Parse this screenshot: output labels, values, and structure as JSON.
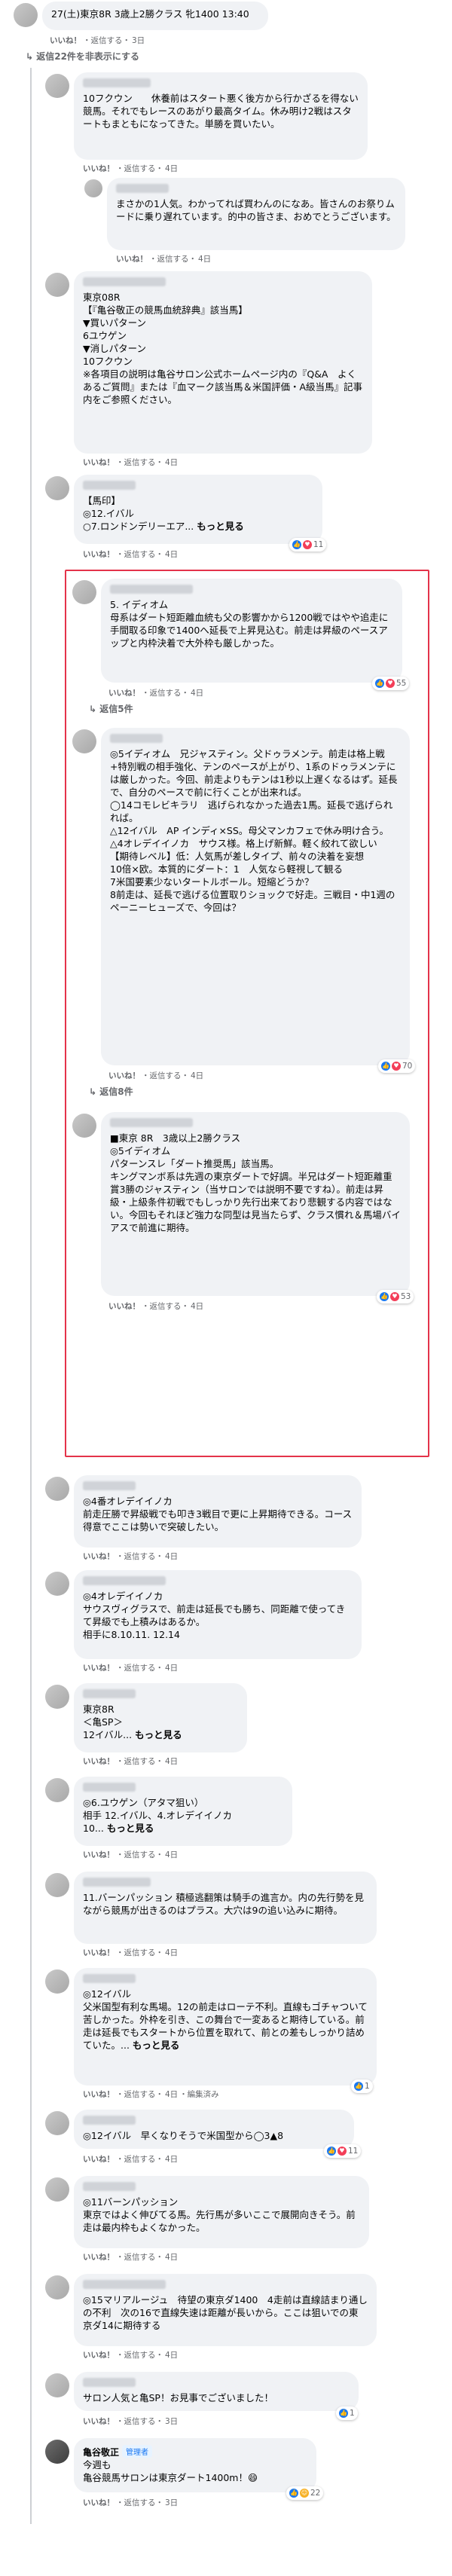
{
  "c0": {
    "text": "27(土)東京8R 3歳上2勝クラス 牝1400 13:40",
    "meta": [
      "いいね！",
      "・返信する・",
      "3日"
    ]
  },
  "hide_replies": "返信22件を非表示にする",
  "c1": {
    "text": "10フクウン　　休養前はスタート悪く後方から行かざるを得ない競馬。それでもレースのあがり最高タイム。休み明け2戦はスタートもまともになってきた。単勝を買いたい。",
    "meta": [
      "いいね！",
      "・返信する・",
      "4日"
    ]
  },
  "c1r": {
    "text": "まさかの1人気。わかってれば買わんのになあ。皆さんのお祭りムードに乗り遅れています。的中の皆さま、おめでとうございます。",
    "meta": [
      "いいね！",
      "・返信する・",
      "4日"
    ]
  },
  "c2": {
    "text": "東京08R\n【『亀谷敬正の競馬血統辞典』該当馬】\n▼買いパターン\n6ユウゲン\n▼消しパターン\n10フクウン\n※各項目の説明は亀谷サロン公式ホームページ内の『Q&A　よくあるご質問』または『血マーク該当馬＆米国評価・A級当馬』記事内をご参照ください。",
    "meta": [
      "いいね！",
      "・返信する・",
      "4日"
    ]
  },
  "c3": {
    "text": "【馬印】\n◎12.イバル\n○7.ロンドンデリーエア...",
    "more": "もっと見る",
    "meta": [
      "いいね！",
      "・返信する・",
      "4日"
    ],
    "reactions": "11"
  },
  "c4": {
    "text": "5. イディオム\n母系はダート短距離血統も父の影響かから1200戦ではやや追走に手間取る印象で1400へ延長で上昇見込む。前走は昇級のペースアップと内枠決着で大外枠も厳しかった。",
    "meta": [
      "いいね！",
      "・返信する・",
      "4日"
    ],
    "reactions": "55",
    "replies": "返信5件"
  },
  "c5": {
    "text": "◎5イディオム　兄ジャスティン。父ドゥラメンテ。前走は格上戦+特別戦の相手強化、テンのペースが上がり、1系のドゥラメンテには厳しかった。今回、前走よりもテンは1秒以上遅くなるはず。延長で、自分のペースで前に行くことが出来れば。\n◯14コモレビキラリ　逃げられなかった過去1馬。延長で逃げられれば。\n△12イバル　AP インディ×SS。母父マンカフェで休み明け合う。\n△4オレデイイノカ　サウス様。格上げ新鮮。軽く絞れて欲しい\n【期待レベル】低：人気馬が差しタイプ、前々の決着を妄想\n10倍×欧。本質的にダート：1　人気なら軽視して観る\n7米国要素少ないタートルボール。短縮どうか？\n8前走は、延長で逃げる位置取りショックで好走。三戦目・中1週のペーニーヒューズで、今回は？",
    "meta": [
      "いいね！",
      "・返信する・",
      "4日"
    ],
    "reactions": "70",
    "replies": "返信8件"
  },
  "c6": {
    "text": "■東京 8R　3歳以上2勝クラス\n◎5イディオム\nパターンスレ「ダート推奨馬」該当馬。\nキングマンボ系は先週の東京ダートで好調。半兄はダート短距離重賞3勝のジャスティン（当サロンでは説明不要ですね）。前走は昇級・上級条件初戦でもしっかり先行出来ており悲観する内容ではない。今回もそれほど強力な同型は見当たらず、クラス慣れ＆馬場バイアスで前進に期待。",
    "meta": [
      "いいね！",
      "・返信する・",
      "4日"
    ],
    "reactions": "53"
  },
  "c7": {
    "text": "◎4番オレデイイノカ\n前走圧勝で昇級戦でも叩き3戦目で更に上昇期待できる。コース得意でここは勢いで突破したい。",
    "meta": [
      "いいね！",
      "・返信する・",
      "4日"
    ]
  },
  "c8": {
    "text": "◎4オレデイイノカ\nサウスヴィグラスで、前走は延長でも勝ち、同距離で使ってきて昇級でも上積みはあるか。\n相手に8.10.11. 12.14",
    "meta": [
      "いいね！",
      "・返信する・",
      "4日"
    ]
  },
  "c9": {
    "text": "東京8R\n＜亀SP＞\n12イバル...",
    "more": "もっと見る",
    "meta": [
      "いいね！",
      "・返信する・",
      "4日"
    ]
  },
  "c10": {
    "text": "◎6.ユウゲン（アタマ狙い）\n相手 12.イバル、4.オレデイイノカ\n10...",
    "more": "もっと見る",
    "meta": [
      "いいね！",
      "・返信する・",
      "4日"
    ]
  },
  "c11": {
    "text": "11.バーンパッション 積極逃翻策は騎手の進言か。内の先行勢を見ながら競馬が出きるのはプラス。大穴は9の追い込みに期待。",
    "meta": [
      "いいね！",
      "・返信する・",
      "4日"
    ]
  },
  "c12": {
    "text": "◎12イバル\n父米国型有利な馬場。12の前走はローテ不利。直線もゴチャついて苦しかった。外枠を引き、この舞台で一変あると期待している。前走は延長でもスタートから位置を取れて、前との差もしっかり詰めていた。...",
    "more": "もっと見る",
    "meta": [
      "いいね！",
      "・返信する・",
      "4日",
      "・編集済み"
    ],
    "reactions": "1"
  },
  "c13": {
    "text": "◎12イバル　早くなりそうで米国型から◯3▲8",
    "meta": [
      "いいね！",
      "・返信する・",
      "4日"
    ],
    "reactions": "11"
  },
  "c14": {
    "text": "◎11バーンパッション\n東京ではよく伸びてる馬。先行馬が多いここで展開向きそう。前走は最内枠もよくなかった。",
    "meta": [
      "いいね！",
      "・返信する・",
      "4日"
    ]
  },
  "c15": {
    "text": "◎15マリアルージュ　待望の東京ダ1400　4走前は直線詰まり通しの不利　次の16で直線失速は距離が長いから。ここは狙いでの東京ダ14に期待する",
    "meta": [
      "いいね！",
      "・返信する・",
      "4日"
    ]
  },
  "c16": {
    "text": "サロン人気と亀SP！お見事でございました！",
    "meta": [
      "いいね！",
      "・返信する・",
      "3日"
    ],
    "reactions": "1"
  },
  "c17": {
    "name": "亀谷敬正",
    "role": "管理者",
    "text": "今週も\n亀谷競馬サロンは東京ダート1400m！😄",
    "meta": [
      "いいね！",
      "・返信する・",
      "3日"
    ],
    "reactions": "22"
  }
}
